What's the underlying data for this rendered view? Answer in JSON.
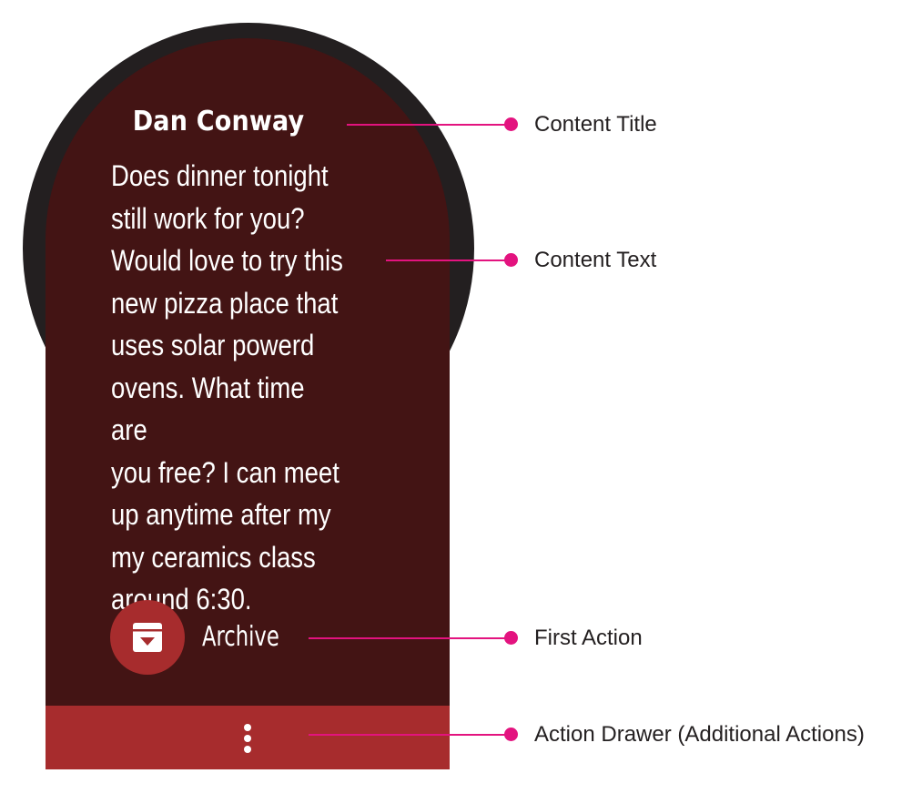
{
  "card": {
    "title": "Dan Conway",
    "text": "Does dinner tonight\nstill work for you?\nWould love to try this\nnew pizza place that\nuses solar powerd\novens. What time are\nyou free? I can meet\nup anytime after my\nmy ceramics class\naround 6:30.",
    "first_action": {
      "label": "Archive",
      "icon": "archive-icon"
    },
    "drawer_icon": "more-vert-icon"
  },
  "annotations": {
    "content_title": "Content Title",
    "content_text": "Content Text",
    "first_action": "First Action",
    "action_drawer": "Action Drawer (Additional Actions)"
  },
  "colors": {
    "bezel": "#231f20",
    "card_background": "#431414",
    "accent": "#a72c2d",
    "callout": "#e3137f",
    "text_on_card": "#ffffff"
  }
}
